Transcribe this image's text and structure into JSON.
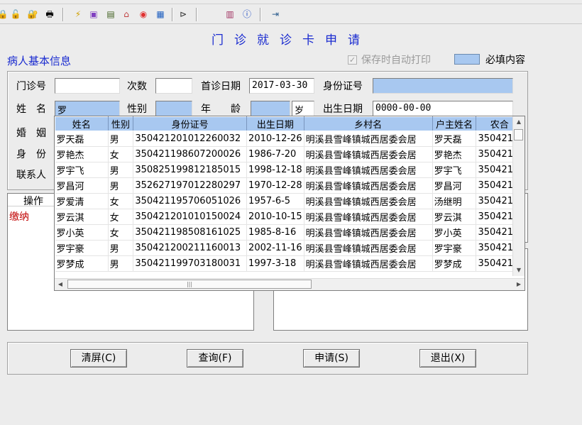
{
  "toolbar": {
    "icons": [
      "lock-icon",
      "lock-open-icon",
      "lock-key-icon",
      "printer-icon",
      "lightning-icon",
      "card-icon",
      "cash-register-icon",
      "ticket-icon",
      "stop-icon",
      "chart-icon",
      "plug-icon",
      "book-icon",
      "info-icon",
      "exit-icon"
    ]
  },
  "window": {
    "title": "门诊就诊卡申请"
  },
  "patient_info": {
    "section_label": "病人基本信息",
    "auto_print_label": "保存时自动打印",
    "auto_print_checked": true,
    "legend_label": "必填内容",
    "required_color": "#a8c8f0",
    "fields": {
      "clinic_no_label": "门诊号",
      "clinic_no_value": "",
      "visits_label": "次数",
      "visits_value": "",
      "first_visit_label": "首诊日期",
      "first_visit_value": "2017-03-30",
      "id_label": "身份证号",
      "id_value": "",
      "name_label": "姓　名",
      "name_value": "罗",
      "gender_label": "性别",
      "gender_value": "",
      "age_label": "年　　龄",
      "age_value": "",
      "age_unit": "岁",
      "birth_label": "出生日期",
      "birth_value": "0000-00-00",
      "marital_label": "婚　姻",
      "identity_label": "身　份",
      "contact_label": "联系人"
    }
  },
  "left_panel": {
    "header": "操作",
    "item": "缴纳"
  },
  "dropdown": {
    "columns": [
      "姓名",
      "性别",
      "身份证号",
      "出生日期",
      "乡村名",
      "户主姓名",
      "农合"
    ],
    "rows": [
      [
        "罗天磊",
        "男",
        "350421201012260032",
        "2010-12-26",
        "明溪县雪峰镇城西居委会居",
        "罗天磊",
        "350421"
      ],
      [
        "罗艳杰",
        "女",
        "350421198607200026",
        "1986-7-20",
        "明溪县雪峰镇城西居委会居",
        "罗艳杰",
        "350421"
      ],
      [
        "罗宇飞",
        "男",
        "350825199812185015",
        "1998-12-18",
        "明溪县雪峰镇城西居委会居",
        "罗宇飞",
        "350421"
      ],
      [
        "罗昌河",
        "男",
        "352627197012280297",
        "1970-12-28",
        "明溪县雪峰镇城西居委会居",
        "罗昌河",
        "350421"
      ],
      [
        "罗爱清",
        "女",
        "350421195706051026",
        "1957-6-5",
        "明溪县雪峰镇城西居委会居",
        "汤继明",
        "350421"
      ],
      [
        "罗云淇",
        "女",
        "350421201010150024",
        "2010-10-15",
        "明溪县雪峰镇城西居委会居",
        "罗云淇",
        "350421"
      ],
      [
        "罗小英",
        "女",
        "350421198508161025",
        "1985-8-16",
        "明溪县雪峰镇城西居委会居",
        "罗小英",
        "350421"
      ],
      [
        "罗宇豪",
        "男",
        "350421200211160013",
        "2002-11-16",
        "明溪县雪峰镇城西居委会居",
        "罗宇豪",
        "350421"
      ],
      [
        "罗梦成",
        "男",
        "350421199703180031",
        "1997-3-18",
        "明溪县雪峰镇城西居委会居",
        "罗梦成",
        "350421"
      ]
    ]
  },
  "buttons": {
    "clear": "清屏(C)",
    "query": "查询(F)",
    "apply": "申请(S)",
    "exit": "退出(X)"
  }
}
